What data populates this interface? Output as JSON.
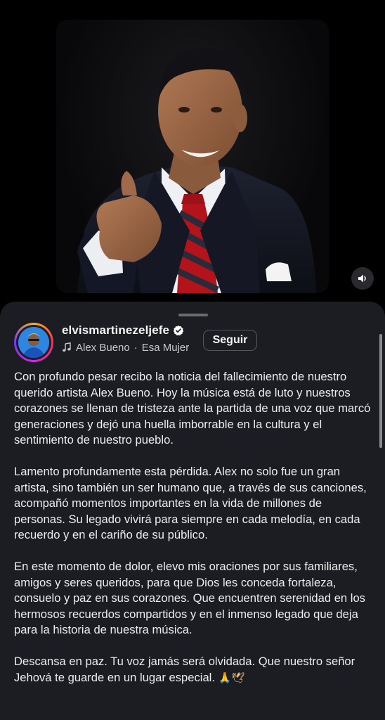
{
  "post": {
    "username": "elvismartinezeljefe",
    "verified_icon": "verified-badge-icon",
    "audio": {
      "icon": "music-note-icon",
      "artist": "Alex Bueno",
      "separator": "·",
      "track": "Esa Mujer"
    },
    "follow_label": "Seguir",
    "media_control_icon": "speaker-icon",
    "caption": [
      "Con profundo pesar recibo la noticia del fallecimiento de nuestro querido artista Alex Bueno. Hoy la música está de luto y nuestros corazones se llenan de tristeza ante la partida de una voz que marcó generaciones y dejó una huella imborrable en la cultura y el sentimiento de nuestro pueblo.",
      "Lamento profundamente esta pérdida. Alex no solo fue un gran artista, sino también un ser humano que, a través de sus canciones, acompañó momentos importantes en la vida de millones de personas. Su legado vivirá para siempre en cada melodía, en cada recuerdo y en el cariño de su público.",
      "En este momento de dolor, elevo mis oraciones por sus familiares, amigos y seres queridos, para que Dios les conceda fortaleza, consuelo y paz en sus corazones. Que encuentren serenidad en los hermosos recuerdos compartidos y en el inmenso legado que deja para la historia de nuestra música.",
      "Descansa en paz. Tu voz jamás será olvidada. Que nuestro señor Jehová te guarde en un lugar especial."
    ],
    "caption_emojis": "🙏🕊"
  },
  "colors": {
    "background": "#000000",
    "sheet": "#1c1d22",
    "verified": "#ffffff",
    "story_ring": [
      "#ffb21a",
      "#ff2b57",
      "#d12adc",
      "#7a35f5"
    ]
  }
}
